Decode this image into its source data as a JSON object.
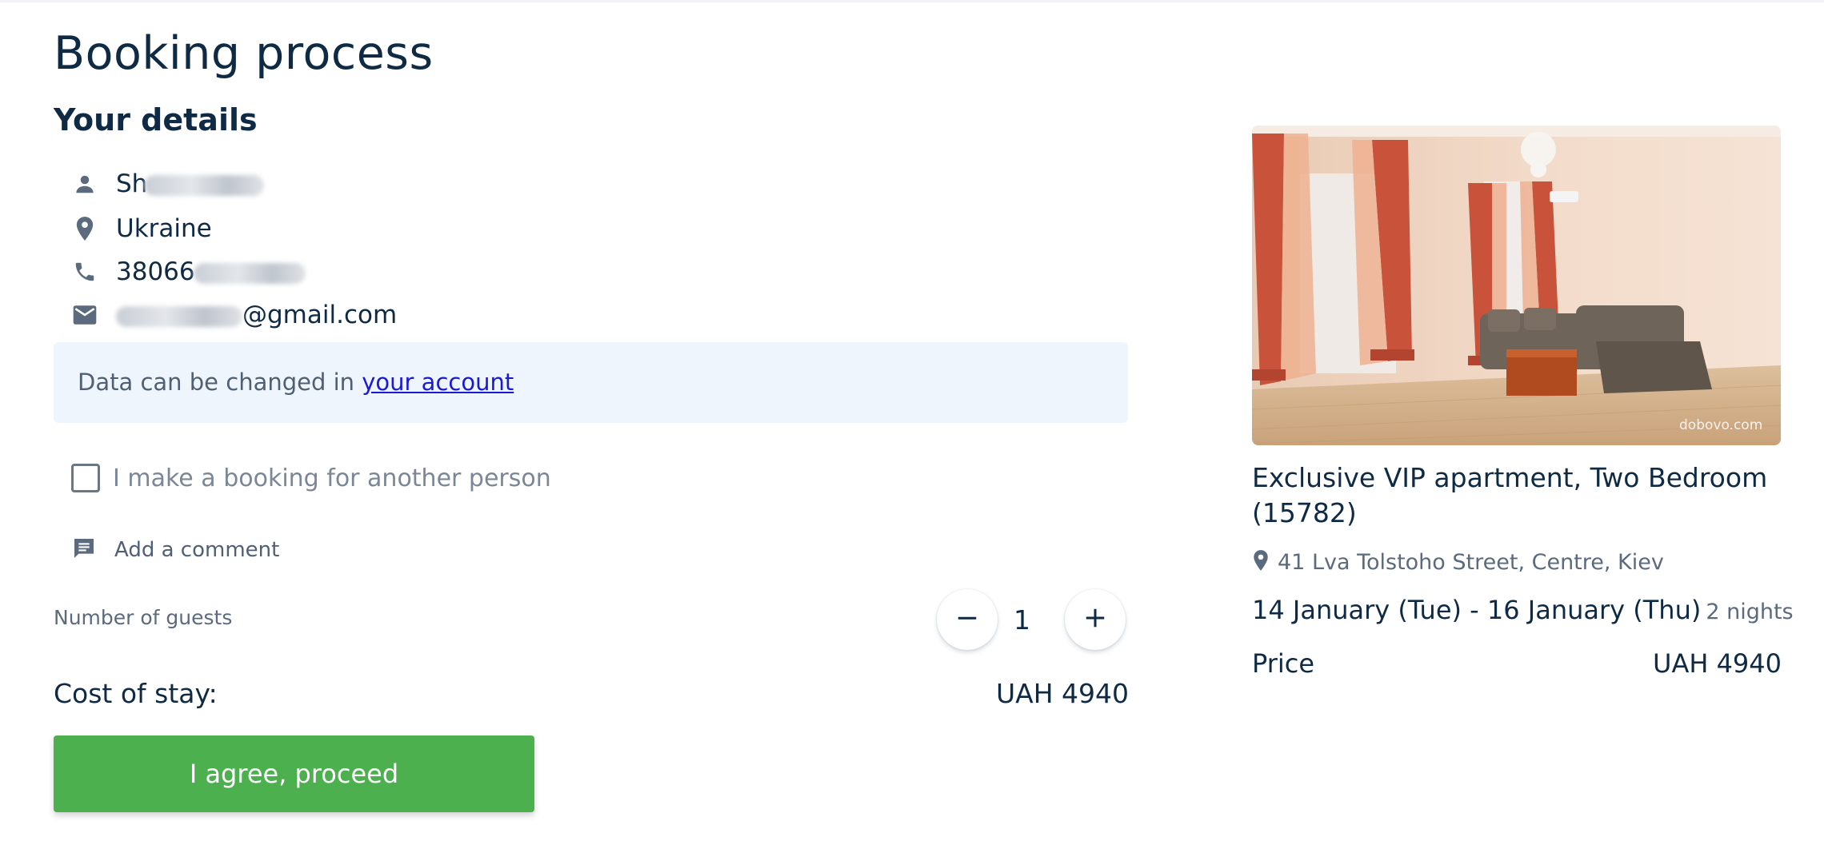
{
  "page": {
    "title": "Booking process",
    "section_title": "Your details"
  },
  "details": {
    "name": "Sh",
    "country": "Ukraine",
    "phone": "38066",
    "email_suffix": "@gmail.com"
  },
  "info": {
    "text": "Data can be changed in ",
    "link": "your account"
  },
  "options": {
    "another_person_label": "I make a booking for another person",
    "comment_label": "Add a comment"
  },
  "guests": {
    "label": "Number of guests",
    "count": "1"
  },
  "cost": {
    "label": "Cost of stay:",
    "value": "UAH 4940"
  },
  "actions": {
    "proceed_label": "I agree, proceed"
  },
  "listing": {
    "title": "Exclusive VIP apartment, Two Bedroom (15782)",
    "address": "41 Lva Tolstoho Street, Centre, Kiev",
    "dates": "14 January (Tue) - 16 January (Thu)",
    "nights": "2 nights",
    "price_label": "Price",
    "price_value": "UAH 4940",
    "watermark": "dobovo.com"
  },
  "colors": {
    "primary_text": "#0f2a44",
    "muted_text": "#5b6a7c",
    "info_bg": "#eef5fc",
    "link": "#1a1ad6",
    "proceed_bg": "#4cb04f"
  }
}
